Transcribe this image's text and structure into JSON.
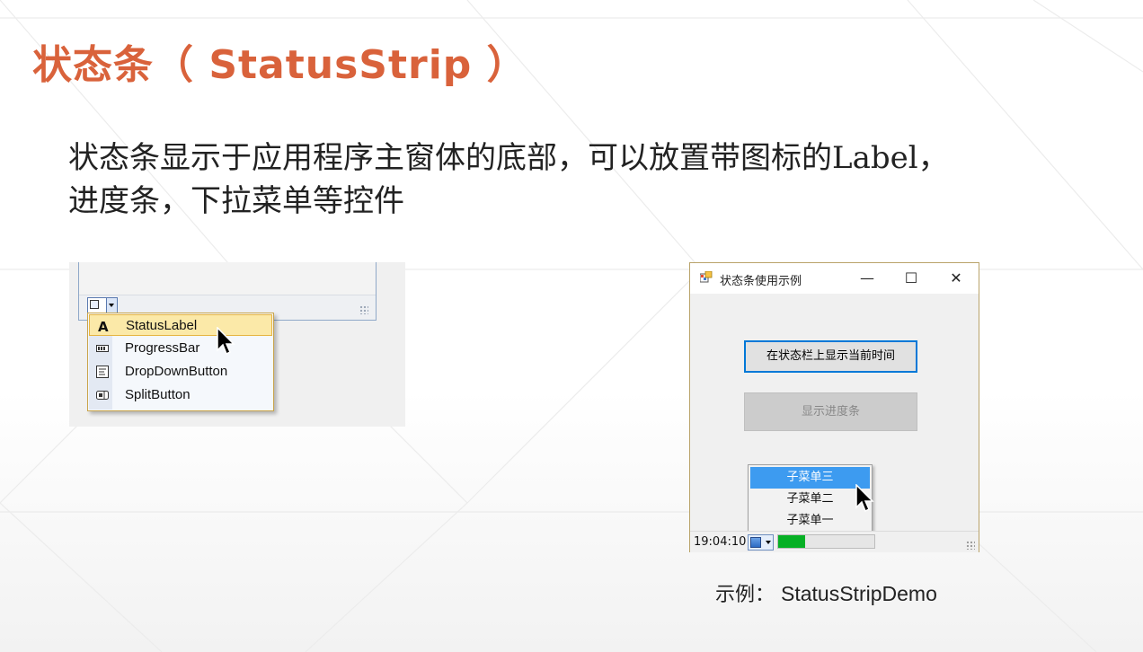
{
  "slide": {
    "title": "状态条（ StatusStrip ）",
    "body_lines": [
      "状态条显示于应用程序主窗体的底部，可以放置带图标的Label，",
      "进度条，下拉菜单等控件"
    ],
    "accent_color": "#d9623b"
  },
  "designer": {
    "menu_items": [
      {
        "label": "StatusLabel",
        "icon": "letter-a-icon",
        "selected": true
      },
      {
        "label": "ProgressBar",
        "icon": "progress-bar-icon",
        "selected": false
      },
      {
        "label": "DropDownButton",
        "icon": "dropdown-button-icon",
        "selected": false
      },
      {
        "label": "SplitButton",
        "icon": "split-button-icon",
        "selected": false
      }
    ]
  },
  "demo_window": {
    "title": "状态条使用示例",
    "controls": {
      "minimize": "—",
      "maximize": "☐",
      "close": "✕"
    },
    "button_show_time": "在状态栏上显示当前时间",
    "button_show_progress": "显示进度条",
    "submenu_items": [
      "子菜单三",
      "子菜单二",
      "子菜单一"
    ],
    "status_time": "19:04:10",
    "progress_value": 0.28,
    "progress_color": "#06b025"
  },
  "caption": {
    "label": "示例：",
    "name": "StatusStripDemo"
  }
}
